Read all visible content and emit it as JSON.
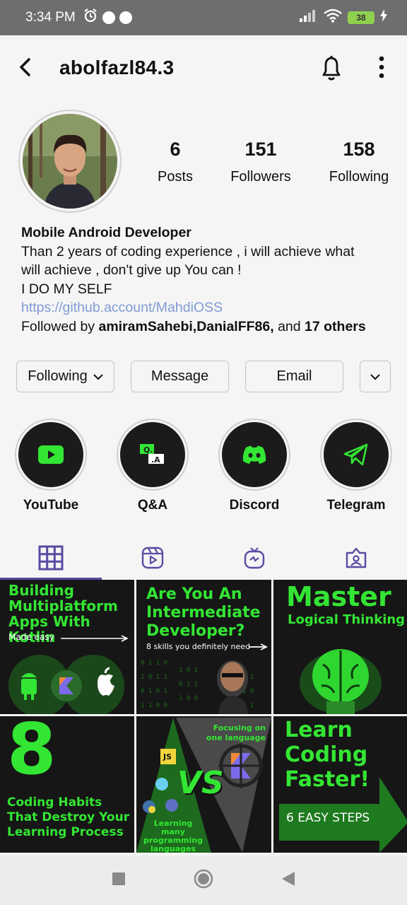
{
  "status_bar": {
    "time": "3:34 PM",
    "battery": "38"
  },
  "header": {
    "username": "abolfazl84.3"
  },
  "stats": [
    {
      "value": "6",
      "label": "Posts"
    },
    {
      "value": "151",
      "label": "Followers"
    },
    {
      "value": "158",
      "label": "Following"
    }
  ],
  "bio": {
    "name": "Mobile Android Developer",
    "line1": "Than 2 years of coding experience , i will achieve what",
    "line2": "will achieve , don't give up You can !",
    "line3": "I DO MY SELF",
    "link": "https://github.account/MahdiOSS",
    "followed_prefix": "Followed by ",
    "followed_names": "amiramSahebi,DanialFF86,",
    "followed_and": " and ",
    "followed_count": "17  others"
  },
  "actions": {
    "following": "Following",
    "message": "Message",
    "email": "Email"
  },
  "highlights": [
    {
      "label": "YouTube",
      "icon": "youtube-icon"
    },
    {
      "label": "Q&A",
      "icon": "qa-icon"
    },
    {
      "label": "Discord",
      "icon": "discord-icon"
    },
    {
      "label": "Telegram",
      "icon": "telegram-icon"
    }
  ],
  "tabs": [
    "grid-icon",
    "reels-icon",
    "igtv-icon",
    "tagged-icon"
  ],
  "posts": {
    "p1": {
      "l1": "Building",
      "l2": "Multiplatform",
      "l3": "Apps With Kotlin",
      "sub": "Made easy"
    },
    "p2": {
      "l1": "Are You An",
      "l2": "Intermediate",
      "l3": "Developer?",
      "sub": "8 skills you definitely need"
    },
    "p3": {
      "l1": "Master",
      "l2": "Logical Thinking"
    },
    "p4": {
      "big": "8",
      "l1": "Coding Habits",
      "l2": "That Destroy Your",
      "l3": "Learning Process"
    },
    "p5": {
      "top": "Focusing on",
      "top2": "one language",
      "vs": "VS",
      "bot1": "Learning many",
      "bot2": "programming",
      "bot3": "languages",
      "js": "JS"
    },
    "p6": {
      "l1": "Learn",
      "l2": "Coding",
      "l3": "Faster!",
      "sub": "6 EASY STEPS"
    }
  },
  "colors": {
    "accent": "#5b4aa3",
    "link": "#7f9bd4",
    "neon": "#33e633",
    "tile_bg": "#161616"
  }
}
